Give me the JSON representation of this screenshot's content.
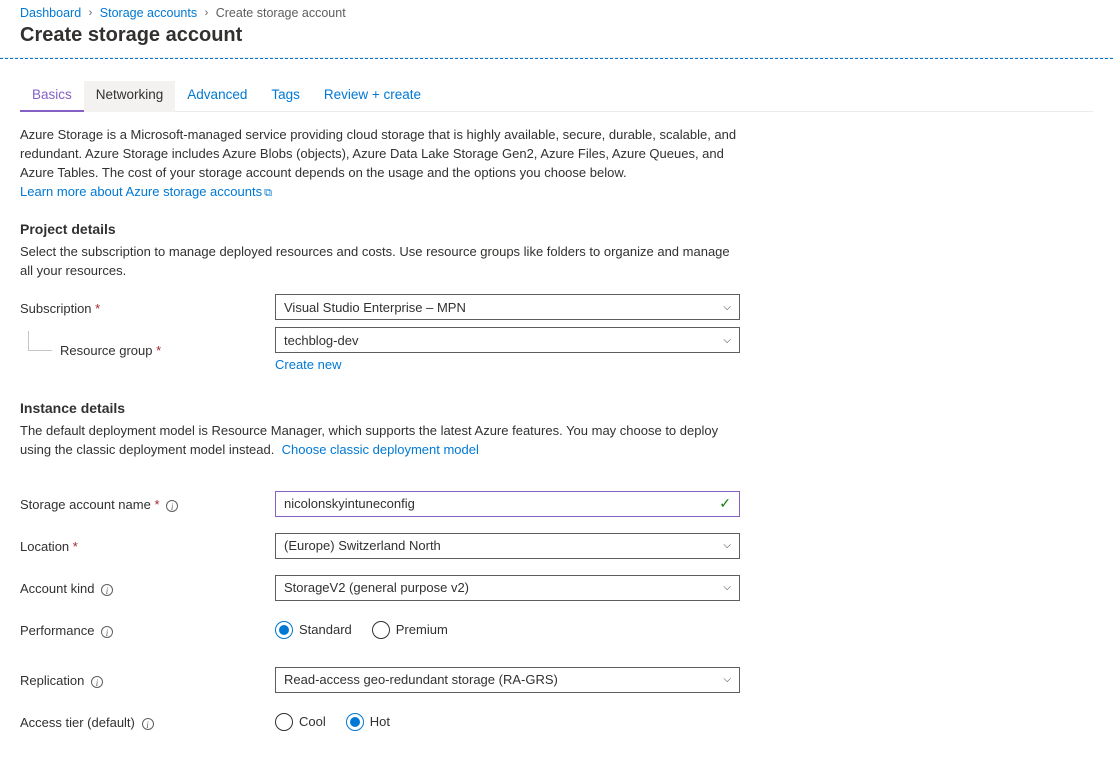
{
  "breadcrumb": {
    "items": [
      {
        "label": "Dashboard",
        "link": true
      },
      {
        "label": "Storage accounts",
        "link": true
      },
      {
        "label": "Create storage account",
        "link": false
      }
    ]
  },
  "title": "Create storage account",
  "tabs": {
    "basics": "Basics",
    "networking": "Networking",
    "advanced": "Advanced",
    "tags": "Tags",
    "review": "Review + create"
  },
  "intro": {
    "text": "Azure Storage is a Microsoft-managed service providing cloud storage that is highly available, secure, durable, scalable, and redundant. Azure Storage includes Azure Blobs (objects), Azure Data Lake Storage Gen2, Azure Files, Azure Queues, and Azure Tables. The cost of your storage account depends on the usage and the options you choose below.",
    "link": "Learn more about Azure storage accounts"
  },
  "project": {
    "heading": "Project details",
    "desc": "Select the subscription to manage deployed resources and costs. Use resource groups like folders to organize and manage all your resources.",
    "subscription_label": "Subscription",
    "subscription_value": "Visual Studio Enterprise – MPN",
    "resource_group_label": "Resource group",
    "resource_group_value": "techblog-dev",
    "create_new": "Create new"
  },
  "instance": {
    "heading": "Instance details",
    "desc_1": "The default deployment model is Resource Manager, which supports the latest Azure features. You may choose to deploy using the classic deployment model instead.",
    "desc_link": "Choose classic deployment model",
    "name_label": "Storage account name",
    "name_value": "nicolonskyintuneconfig",
    "location_label": "Location",
    "location_value": "(Europe) Switzerland North",
    "kind_label": "Account kind",
    "kind_value": "StorageV2 (general purpose v2)",
    "performance_label": "Performance",
    "performance_options": {
      "standard": "Standard",
      "premium": "Premium"
    },
    "replication_label": "Replication",
    "replication_value": "Read-access geo-redundant storage (RA-GRS)",
    "tier_label": "Access tier (default)",
    "tier_options": {
      "cool": "Cool",
      "hot": "Hot"
    }
  }
}
